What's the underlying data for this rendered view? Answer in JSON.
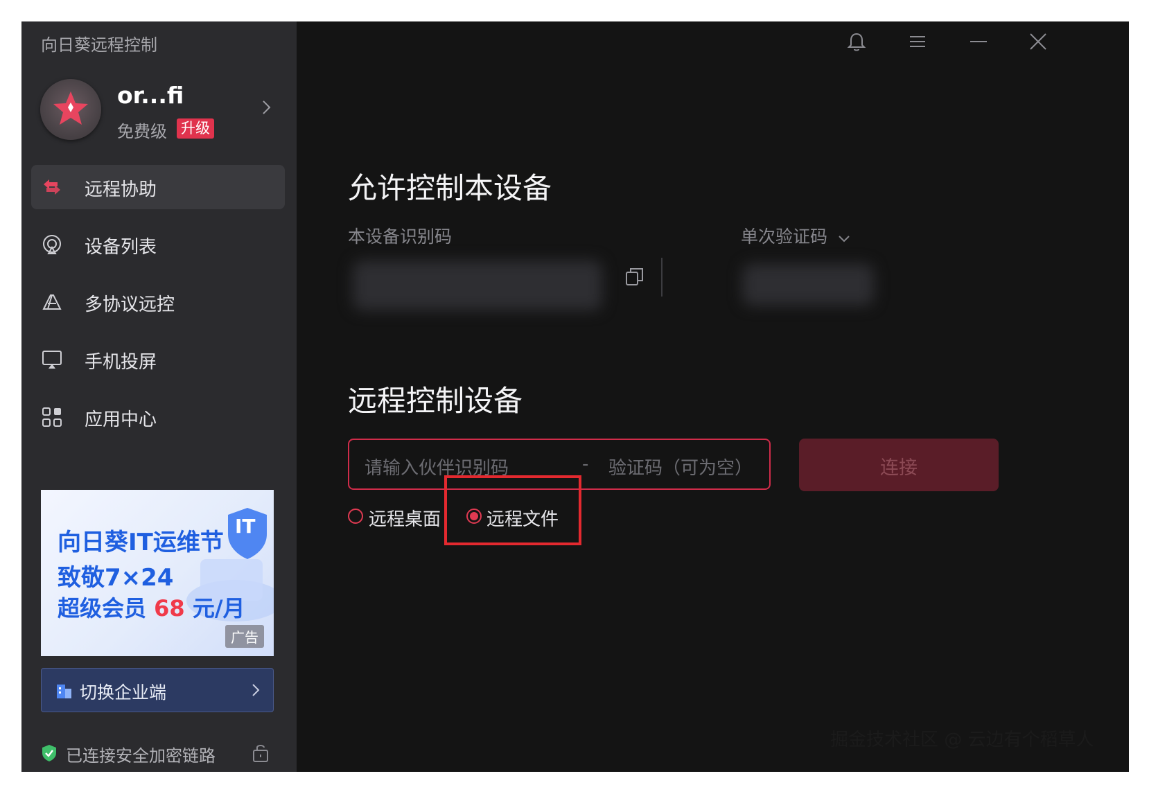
{
  "app": {
    "title": "向日葵远程控制"
  },
  "profile": {
    "username": "or...fi",
    "tier": "免费级",
    "upgrade_label": "升级"
  },
  "sidebar": {
    "items": [
      {
        "label": "远程协助",
        "icon": "remote-assist-icon",
        "active": true
      },
      {
        "label": "设备列表",
        "icon": "device-list-icon",
        "active": false
      },
      {
        "label": "多协议远控",
        "icon": "multi-protocol-icon",
        "active": false
      },
      {
        "label": "手机投屏",
        "icon": "screen-cast-icon",
        "active": false
      },
      {
        "label": "应用中心",
        "icon": "app-grid-icon",
        "active": false
      }
    ],
    "ad": {
      "line1": "向日葵IT运维节",
      "line2": "致敬7×24",
      "line3_prefix": "超级会员",
      "line3_price": "68",
      "line3_suffix": "元/月",
      "badge": "IT",
      "tag": "广告"
    },
    "enterprise_label": "切换企业端",
    "security_status": "已连接安全加密链路"
  },
  "allow_control": {
    "title": "允许控制本设备",
    "device_id_label": "本设备识别码",
    "verify_mode_label": "单次验证码"
  },
  "remote_control": {
    "title": "远程控制设备",
    "partner_id_placeholder": "请输入伙伴识别码",
    "separator": "-",
    "code_placeholder": "验证码（可为空）",
    "connect_label": "连接",
    "modes": [
      {
        "label": "远程桌面",
        "checked": false
      },
      {
        "label": "远程文件",
        "checked": true
      }
    ]
  },
  "watermark": "掘金技术社区 @ 云边有个稻草人",
  "colors": {
    "accent": "#e03a52",
    "sidebar_bg": "#2b2b2e",
    "main_bg": "#141414"
  }
}
